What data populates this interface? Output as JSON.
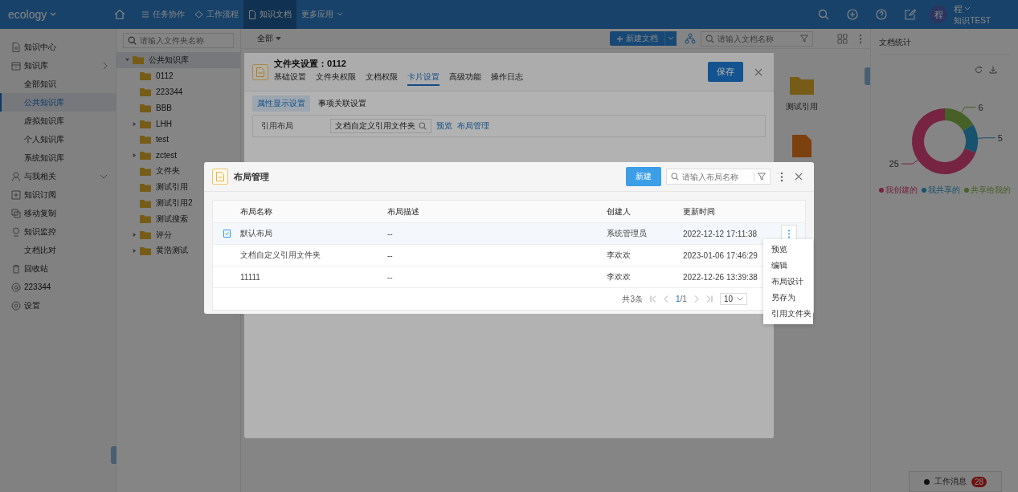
{
  "topbar": {
    "logo": "ecology",
    "nav": [
      {
        "label": "任务协作",
        "kind": "list",
        "selected": false
      },
      {
        "label": "工作流程",
        "kind": "flow",
        "selected": false
      },
      {
        "label": "知识文档",
        "kind": "doc",
        "selected": true
      },
      {
        "label": "更多应用",
        "kind": "more",
        "selected": false
      }
    ],
    "user": {
      "avatar": "程",
      "name": "程",
      "dept": "知识TEST"
    }
  },
  "sidebar": {
    "items": [
      {
        "label": "知识中心",
        "kind": "doc",
        "selected": false
      },
      {
        "label": "知识库",
        "kind": "box",
        "expanded": false,
        "selected": false,
        "children": [
          {
            "label": "全部知识",
            "selected": false
          },
          {
            "label": "公共知识库",
            "selected": true
          },
          {
            "label": "虚拟知识库",
            "selected": false
          },
          {
            "label": "个人知识库",
            "selected": false
          },
          {
            "label": "系统知识库",
            "selected": false
          }
        ]
      },
      {
        "label": "与我相关",
        "kind": "user",
        "expanded": true,
        "selected": false
      },
      {
        "label": "知识订阅",
        "kind": "plus",
        "selected": false
      },
      {
        "label": "移动复制",
        "kind": "copy",
        "selected": false
      },
      {
        "label": "知识监控",
        "kind": "pin",
        "selected": false
      },
      {
        "label": "文档比对",
        "selected": false
      },
      {
        "label": "回收站",
        "kind": "trash",
        "selected": false
      },
      {
        "label": "223344",
        "kind": "at",
        "selected": false
      },
      {
        "label": "设置",
        "kind": "gear",
        "selected": false
      }
    ]
  },
  "folder_tree": {
    "search": {
      "placeholder": "请输入文件夹名称"
    },
    "root": {
      "label": "公共知识库",
      "expanded": true,
      "selected": true,
      "children": [
        {
          "label": "0112",
          "selected": false
        },
        {
          "label": "223344",
          "selected": false
        },
        {
          "label": "BBB",
          "selected": false
        },
        {
          "label": "LHH",
          "expanded": false,
          "selected": false
        },
        {
          "label": "test",
          "selected": false
        },
        {
          "label": "zctest",
          "expanded": false,
          "selected": false
        },
        {
          "label": "文件夹",
          "selected": false
        },
        {
          "label": "测试引用",
          "selected": false
        },
        {
          "label": "测试引用2",
          "selected": false
        },
        {
          "label": "测试搜索",
          "selected": false
        },
        {
          "label": "评分",
          "expanded": false,
          "selected": false
        },
        {
          "label": "黄浩测试",
          "expanded": false,
          "selected": false
        }
      ]
    }
  },
  "content": {
    "filter": "全部",
    "new_button": "新建文档",
    "search": {
      "placeholder": "请输入文档名称"
    },
    "tiles": [
      {
        "label": "测试引用",
        "kind": "folder"
      },
      {
        "kind": "file"
      }
    ]
  },
  "stats": {
    "title": "文档统计",
    "chart_data": {
      "type": "donut",
      "data_labels": true,
      "series": [
        {
          "values": [
            25,
            5,
            6
          ]
        }
      ]
    },
    "legend": [
      {
        "label": "我创建的",
        "color": "#762441"
      },
      {
        "label": "我共享的",
        "color": "#18536d"
      },
      {
        "label": "共享给我的",
        "color": "#466027"
      }
    ]
  },
  "work_message": {
    "label": "工作消息",
    "count": "28"
  },
  "folder_dialog": {
    "title": "文件夹设置：0112",
    "save": "保存",
    "tabs": [
      {
        "label": "基础设置",
        "selected": false
      },
      {
        "label": "文件夹权限",
        "selected": false
      },
      {
        "label": "文档权限",
        "selected": false
      },
      {
        "label": "卡片设置",
        "selected": true
      },
      {
        "label": "高级功能",
        "selected": false
      },
      {
        "label": "操作日志",
        "selected": false
      }
    ],
    "subtabs": [
      {
        "label": "属性显示设置",
        "selected": true
      },
      {
        "label": "事项关联设置",
        "selected": false
      }
    ],
    "field": {
      "label": "引用布局",
      "value": "文档自定义引用文件夹",
      "links": [
        "预览",
        "布局管理"
      ]
    }
  },
  "layout_dialog": {
    "title": "布局管理",
    "new_button": "新建",
    "search": {
      "placeholder": "请输入布局名称"
    },
    "columns": [
      "布局名称",
      "布局描述",
      "创建人",
      "更新时间"
    ],
    "rows": [
      {
        "default": true,
        "name": "默认布局",
        "description": "--",
        "creator": "系统管理员",
        "updated": "2022-12-12 17:11:38",
        "menu_open": true
      },
      {
        "default": false,
        "name": "文档自定义引用文件夹",
        "description": "--",
        "creator": "李欢欢",
        "updated": "2023-01-06 17:46:29",
        "menu_open": false
      },
      {
        "default": false,
        "name": "11111",
        "description": "--",
        "creator": "李欢欢",
        "updated": "2022-12-26 13:39:38",
        "menu_open": false
      }
    ],
    "pagination": {
      "total": "共3条",
      "current": "1",
      "pages": "/1",
      "page_size": "10"
    },
    "row_menu": [
      "预览",
      "编辑",
      "布局设计",
      "另存为",
      "引用文件夹"
    ]
  }
}
